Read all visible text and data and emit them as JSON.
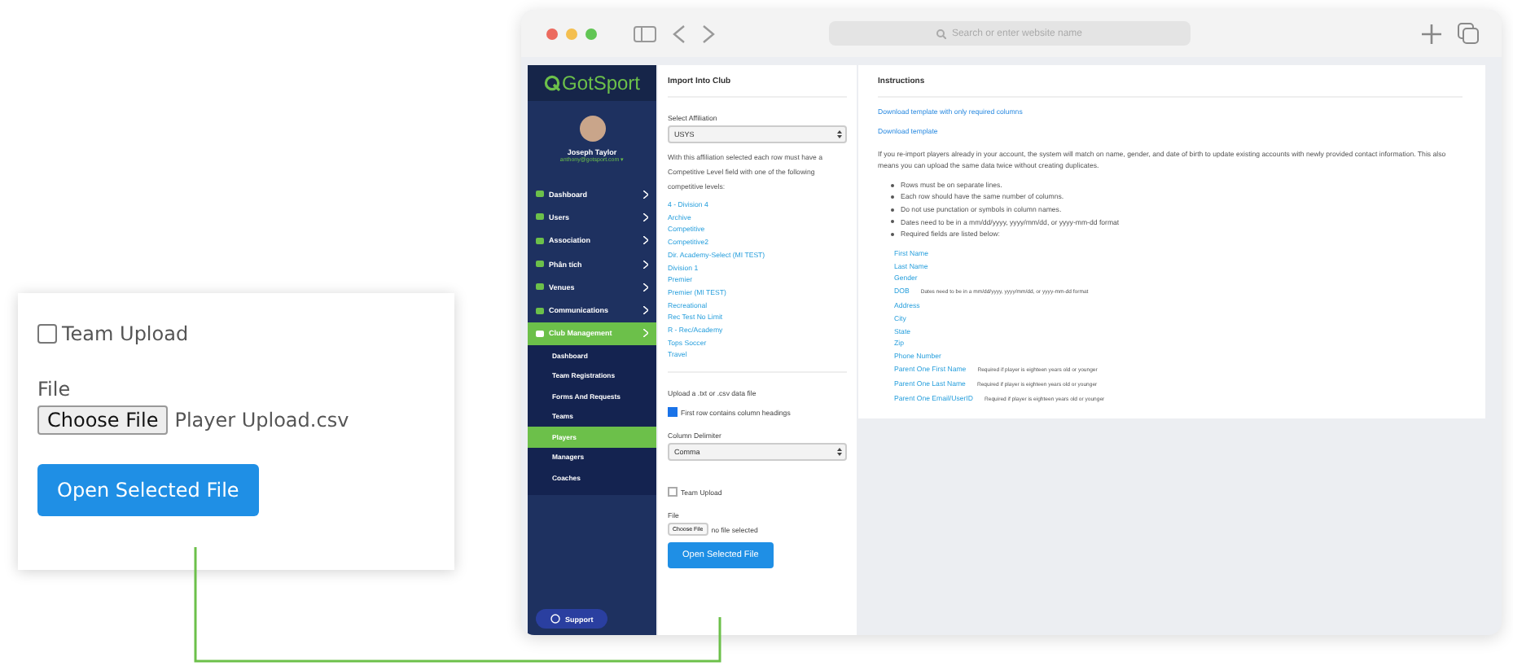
{
  "browser": {
    "address_placeholder": "Search or enter website name"
  },
  "sidebar": {
    "logo": "GotSport",
    "user": {
      "name": "Joseph Taylor",
      "email": "anthony@gotsport.com ▾"
    },
    "items": [
      {
        "label": "Dashboard",
        "selected": false
      },
      {
        "label": "Users",
        "selected": false
      },
      {
        "label": "Association",
        "selected": false
      },
      {
        "label": "Phân tích",
        "selected": false
      },
      {
        "label": "Venues",
        "selected": false
      },
      {
        "label": "Communications",
        "selected": false
      },
      {
        "label": "Club Management",
        "selected": true,
        "children": [
          {
            "label": "Dashboard",
            "selected": false
          },
          {
            "label": "Team Registrations",
            "selected": false
          },
          {
            "label": "Forms And Requests",
            "selected": false
          },
          {
            "label": "Teams",
            "selected": false
          },
          {
            "label": "Players",
            "selected": true
          },
          {
            "label": "Managers",
            "selected": false
          },
          {
            "label": "Coaches",
            "selected": false
          }
        ]
      }
    ],
    "support": "Support"
  },
  "import_panel": {
    "title": "Import Into Club",
    "affiliation_label": "Select Affiliation",
    "affiliation_value": "USYS",
    "description": "With this affiliation selected each row must have a Competitive Level field with one of the following competitive levels:",
    "levels": [
      "4 - Division 4",
      "Archive",
      "Competitive",
      "Competitive2",
      "Dir. Academy-Select (MI TEST)",
      "Division 1",
      "Premier",
      "Premier (MI TEST)",
      "Recreational",
      "Rec Test No Limit",
      "R - Rec/Academy",
      "Tops Soccer",
      "Travel"
    ],
    "upload_label": "Upload a .txt or .csv data file",
    "first_row": {
      "label": "First row contains column headings",
      "checked": true
    },
    "delimiter_label": "Column Delimiter",
    "delimiter_value": "Comma",
    "team_upload": {
      "label": "Team Upload",
      "checked": false
    },
    "file_label": "File",
    "choose_button": "Choose File",
    "file_status": "no file selected",
    "open_button": "Open Selected File"
  },
  "instructions": {
    "title": "Instructions",
    "links": [
      "Download template with only required columns",
      "Download template"
    ],
    "paragraph": "If you re-import players already in your account, the system will match on name, gender, and date of birth to update existing accounts with newly provided contact information. This also means you can upload the same data twice without creating duplicates.",
    "rules": [
      "Rows must be on separate lines.",
      "Each row should have the same number of columns.",
      "Do not use punctation or symbols in column names.",
      "Dates need to be in a mm/dd/yyyy, yyyy/mm/dd, or yyyy-mm-dd format",
      "Required fields are listed below:"
    ],
    "fields": [
      {
        "name": "First Name"
      },
      {
        "name": "Last Name"
      },
      {
        "name": "Gender"
      },
      {
        "name": "DOB",
        "note": "Dates need to be in a mm/dd/yyyy, yyyy/mm/dd, or yyyy-mm-dd format"
      },
      {
        "name": "Address"
      },
      {
        "name": "City"
      },
      {
        "name": "State"
      },
      {
        "name": "Zip"
      },
      {
        "name": "Phone Number"
      },
      {
        "name": "Parent One First Name",
        "note": "Required if player is eighteen years old or younger"
      },
      {
        "name": "Parent One Last Name",
        "note": "Required if player is eighteen years old or younger"
      },
      {
        "name": "Parent One Email/UserID",
        "note": "Required if player is eighteen years old or younger"
      }
    ]
  },
  "zoom_card": {
    "team_upload": {
      "label": "Team Upload",
      "checked": false
    },
    "file_label": "File",
    "choose_button": "Choose File",
    "file_name": "Player Upload.csv",
    "open_button": "Open Selected File"
  }
}
